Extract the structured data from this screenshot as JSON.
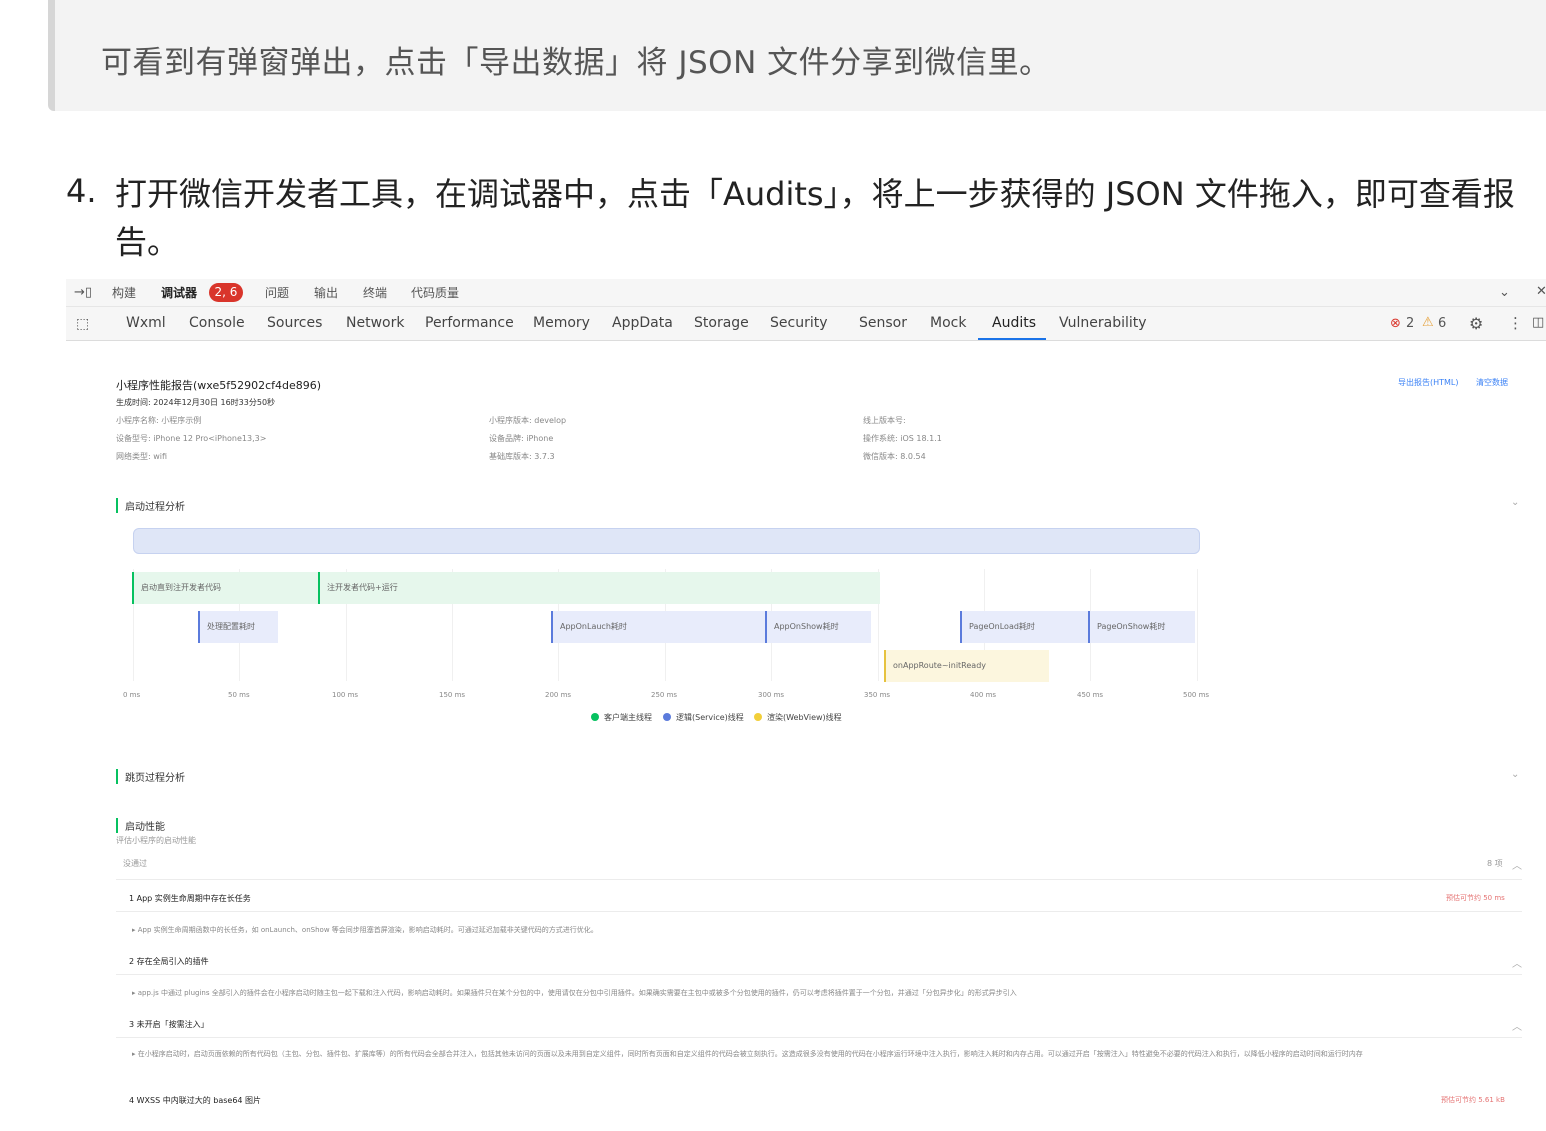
{
  "article": {
    "quote": "可看到有弹窗弹出，点击「导出数据」将 JSON 文件分享到微信里。",
    "step_number": "4.",
    "step_text": "打开微信开发者工具，在调试器中，点击「Audits」，将上一步获得的 JSON 文件拖入，即可查看报告。"
  },
  "devtools": {
    "top_tabs": [
      "构建",
      "调试器",
      "问题",
      "输出",
      "终端",
      "代码质量"
    ],
    "debugger_badge": "2, 6",
    "panel_tabs": [
      "Wxml",
      "Console",
      "Sources",
      "Network",
      "Performance",
      "Memory",
      "AppData",
      "Storage",
      "Security",
      "Sensor",
      "Mock",
      "Audits",
      "Vulnerability"
    ],
    "active_panel": "Audits",
    "error_count": "2",
    "warning_count": "6",
    "colors": {
      "error": "#d9352b",
      "warning": "#e6a23c",
      "accent": "#1a73e8"
    }
  },
  "report": {
    "title": "小程序性能报告(wxe5f52902cf4de896)",
    "generated": "生成时间: 2024年12月30日 16时33分50秒",
    "export_html": "导出报告(HTML)",
    "clear_data": "清空数据",
    "meta": [
      [
        "小程序名称: 小程序示例",
        "小程序版本: develop",
        "线上版本号:"
      ],
      [
        "设备型号: iPhone 12 Pro<iPhone13,3>",
        "设备品牌: iPhone",
        "操作系统: iOS 18.1.1"
      ],
      [
        "网络类型: wifi",
        "基础库版本: 3.7.3",
        "微信版本: 8.0.54"
      ]
    ],
    "startup_section": "启动过程分析",
    "timeline": {
      "bars": [
        {
          "label": "启动直到注开发者代码",
          "thread": "green"
        },
        {
          "label": "注开发者代码+运行",
          "thread": "green"
        },
        {
          "label": "处理配置耗时",
          "thread": "blue"
        },
        {
          "label": "AppOnLauch耗时",
          "thread": "blue"
        },
        {
          "label": "AppOnShow耗时",
          "thread": "blue"
        },
        {
          "label": "PageOnLoad耗时",
          "thread": "blue"
        },
        {
          "label": "PageOnShow耗时",
          "thread": "blue"
        },
        {
          "label": "onAppRoute~initReady",
          "thread": "yellow"
        }
      ],
      "ticks": [
        "0 ms",
        "50 ms",
        "100 ms",
        "150 ms",
        "200 ms",
        "250 ms",
        "300 ms",
        "350 ms",
        "400 ms",
        "450 ms",
        "500 ms"
      ],
      "legend": [
        "客户端主线程",
        "逻辑(Service)线程",
        "渲染(WebView)线程"
      ],
      "legend_colors": [
        "#07c160",
        "#5b7bdc",
        "#f2cf3a"
      ]
    },
    "navigation_section": "跳页过程分析",
    "performance_section": "启动性能",
    "performance_sub": "评估小程序的启动性能",
    "not_passed": "没通过",
    "count": "8 项",
    "items": [
      {
        "title": "1 App 实例生命周期中存在长任务",
        "desc": "▸ App 实例生命周期函数中的长任务，如 onLaunch、onShow 等会同步阻塞首屏渲染，影响启动耗时。可通过延迟加载非关键代码的方式进行优化。",
        "save": "预估可节约 50 ms"
      },
      {
        "title": "2 存在全局引入的插件",
        "desc": "▸ app.js 中通过 plugins 全部引入的插件会在小程序启动时随主包一起下载和注入代码，影响启动耗时。如果插件只在某个分包的中，使用请仅在分包中引用插件。如果确实需要在主包中或被多个分包使用的插件，仍可以考虑将插件置于一个分包，并通过「分包异步化」的形式异步引入",
        "save": ""
      },
      {
        "title": "3 未开启「按需注入」",
        "desc": "▸ 在小程序启动时，启动页面依赖的所有代码包（主包、分包、插件包、扩展库等）的所有代码会全部合并注入，包括其他未访问的页面以及未用到自定义组件，同时所有页面和自定义组件的代码会被立刻执行。这造成很多没有使用的代码在小程序运行环境中注入执行，影响注入耗时和内存占用。可以通过开启「按需注入」特性避免不必要的代码注入和执行，以降低小程序的启动时间和运行时内存",
        "save": ""
      },
      {
        "title": "4 WXSS 中内联过大的 base64 图片",
        "desc": "",
        "save": "预估可节约 5.61 kB"
      }
    ]
  }
}
